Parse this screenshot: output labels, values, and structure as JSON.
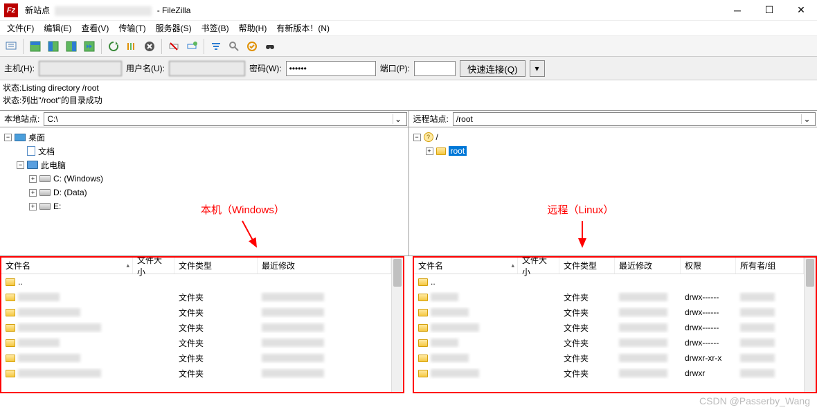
{
  "titlebar": {
    "site_prefix": "新站点",
    "app_name": "FileZilla"
  },
  "menu": {
    "file": "文件(F)",
    "edit": "编辑(E)",
    "view": "查看(V)",
    "transfer": "传输(T)",
    "server": "服务器(S)",
    "bookmarks": "书签(B)",
    "help": "帮助(H)",
    "new_version": "有新版本！(N)"
  },
  "quickconnect": {
    "host_label": "主机(H):",
    "user_label": "用户名(U):",
    "pass_label": "密码(W):",
    "pass_value": "••••••",
    "port_label": "端口(P):",
    "port_value": "",
    "button": "快速连接(Q)"
  },
  "log": {
    "line1_prefix": "状态:",
    "line1_text": "Listing directory /root",
    "line2_prefix": "状态:",
    "line2_text": "列出\"/root\"的目录成功"
  },
  "local": {
    "label": "本地站点:",
    "path": "C:\\",
    "tree": {
      "desktop": "桌面",
      "documents": "文档",
      "computer": "此电脑",
      "c_drive": "C: (Windows)",
      "d_drive": "D: (Data)",
      "e_drive": "E:"
    },
    "annotation": "本机（Windows）",
    "columns": {
      "name": "文件名",
      "size": "文件大小",
      "type": "文件类型",
      "modified": "最近修改"
    },
    "parent": "..",
    "rows": [
      {
        "type": "文件夹"
      },
      {
        "type": "文件夹"
      },
      {
        "type": "文件夹"
      },
      {
        "type": "文件夹"
      },
      {
        "type": "文件夹"
      },
      {
        "type": "文件夹"
      }
    ]
  },
  "remote": {
    "label": "远程站点:",
    "path": "/root",
    "tree": {
      "root_slash": "/",
      "root_folder": "root"
    },
    "annotation": "远程（Linux）",
    "columns": {
      "name": "文件名",
      "size": "文件大小",
      "type": "文件类型",
      "modified": "最近修改",
      "perms": "权限",
      "owner": "所有者/组"
    },
    "parent": "..",
    "rows": [
      {
        "type": "文件夹",
        "perms": "drwx------"
      },
      {
        "type": "文件夹",
        "perms": "drwx------"
      },
      {
        "type": "文件夹",
        "perms": "drwx------"
      },
      {
        "type": "文件夹",
        "perms": "drwx------"
      },
      {
        "type": "文件夹",
        "perms": "drwxr-xr-x"
      },
      {
        "type": "文件夹",
        "perms": "drwxr"
      }
    ]
  },
  "watermark": "CSDN @Passerby_Wang"
}
